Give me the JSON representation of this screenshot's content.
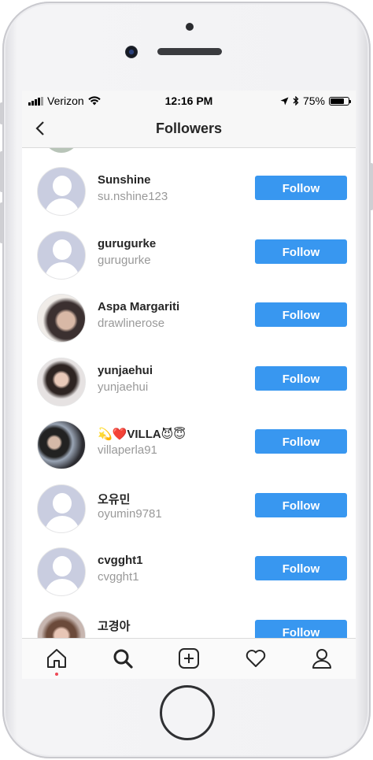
{
  "status_bar": {
    "carrier": "Verizon",
    "time": "12:16 PM",
    "battery": "75%",
    "battery_level": 0.75
  },
  "header": {
    "title": "Followers",
    "back_icon": "chevron-left-icon"
  },
  "followers": [
    {
      "name": "Sunshine",
      "handle": "su.nshine123",
      "avatar": "default",
      "action": "Follow"
    },
    {
      "name": "gurugurke",
      "handle": "gurugurke",
      "avatar": "default",
      "action": "Follow"
    },
    {
      "name": "Aspa Margariti",
      "handle": "drawlinerose",
      "avatar": "photo",
      "action": "Follow"
    },
    {
      "name": "yunjaehui",
      "handle": "yunjaehui",
      "avatar": "photo",
      "action": "Follow"
    },
    {
      "name": "💫❤️VILLA😈😇",
      "handle": "villaperla91",
      "avatar": "photo",
      "action": "Follow"
    },
    {
      "name": "오유민",
      "handle": "oyumin9781",
      "avatar": "default",
      "action": "Follow"
    },
    {
      "name": "cvgght1",
      "handle": "cvgght1",
      "avatar": "default",
      "action": "Follow"
    },
    {
      "name": "고경아",
      "handle": "",
      "avatar": "photo",
      "action": "Follow"
    }
  ],
  "tab_bar": {
    "tabs": [
      "home-icon",
      "search-icon",
      "add-post-icon",
      "activity-heart-icon",
      "profile-icon"
    ],
    "active_tab": "search-icon",
    "notification_dot_color": "#ed4956"
  },
  "colors": {
    "follow_button": "#3897f0",
    "handle_text": "#999999",
    "name_text": "#262626"
  }
}
